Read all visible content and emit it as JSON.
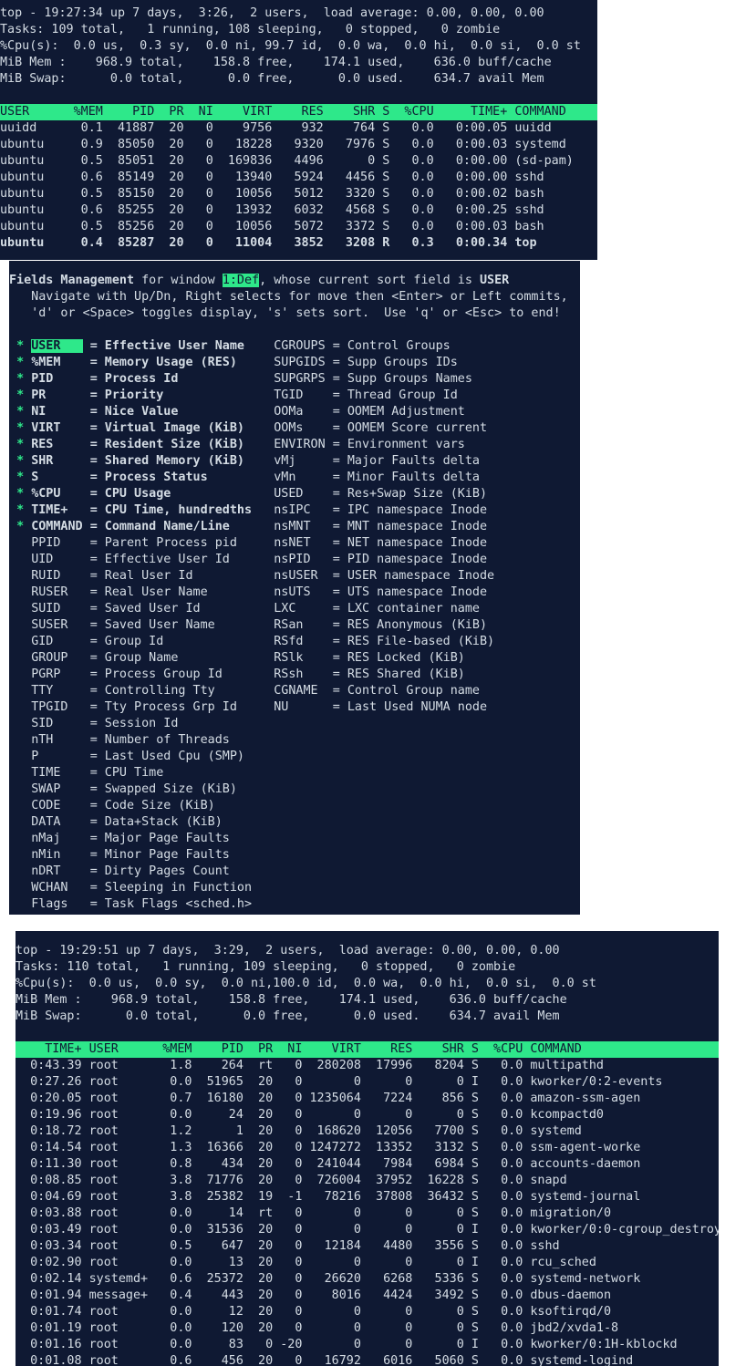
{
  "panel1": {
    "summary": [
      "top - 19:27:34 up 7 days,  3:26,  2 users,  load average: 0.00, 0.00, 0.00",
      "Tasks: 109 total,   1 running, 108 sleeping,   0 stopped,   0 zombie",
      "%Cpu(s):  0.0 us,  0.3 sy,  0.0 ni, 99.7 id,  0.0 wa,  0.0 hi,  0.0 si,  0.0 st",
      "MiB Mem :    968.9 total,    158.8 free,    174.1 used,    636.0 buff/cache",
      "MiB Swap:      0.0 total,      0.0 free,      0.0 used.    634.7 avail Mem"
    ],
    "header": "USER      %MEM    PID  PR  NI    VIRT    RES    SHR S  %CPU     TIME+ COMMAND         ",
    "rows": [
      "uuidd      0.1  41887  20   0    9756    932    764 S   0.0   0:00.05 uuidd",
      "ubuntu     0.9  85050  20   0   18228   9320   7976 S   0.0   0:00.03 systemd",
      "ubuntu     0.5  85051  20   0  169836   4496      0 S   0.0   0:00.00 (sd-pam)",
      "ubuntu     0.6  85149  20   0   13940   5924   4456 S   0.0   0:00.00 sshd",
      "ubuntu     0.5  85150  20   0   10056   5012   3320 S   0.0   0:00.02 bash",
      "ubuntu     0.6  85255  20   0   13932   6032   4568 S   0.0   0:00.25 sshd",
      "ubuntu     0.5  85256  20   0   10056   5072   3372 S   0.0   0:00.03 bash"
    ],
    "active_row": "ubuntu     0.4  85287  20   0   11004   3852   3208 R   0.3   0:00.34 top"
  },
  "panel2": {
    "title_a": "Fields Management",
    "title_b": " for window ",
    "window": "1:Def",
    "title_c": ", whose current sort field is ",
    "sort_field": "USER",
    "instructions": [
      "   Navigate with Up/Dn, Right selects for move then <Enter> or Left commits,",
      "   'd' or <Space> toggles display, 's' sets sort.  Use 'q' or <Esc> to end!"
    ],
    "left_fields": [
      {
        "mark": "*",
        "name": "USER   ",
        "desc": "= Effective User Name ",
        "on": true,
        "sel": true
      },
      {
        "mark": "*",
        "name": "%MEM   ",
        "desc": "= Memory Usage (RES)  ",
        "on": true
      },
      {
        "mark": "*",
        "name": "PID    ",
        "desc": "= Process Id          ",
        "on": true
      },
      {
        "mark": "*",
        "name": "PR     ",
        "desc": "= Priority            ",
        "on": true
      },
      {
        "mark": "*",
        "name": "NI     ",
        "desc": "= Nice Value          ",
        "on": true
      },
      {
        "mark": "*",
        "name": "VIRT   ",
        "desc": "= Virtual Image (KiB) ",
        "on": true
      },
      {
        "mark": "*",
        "name": "RES    ",
        "desc": "= Resident Size (KiB) ",
        "on": true
      },
      {
        "mark": "*",
        "name": "SHR    ",
        "desc": "= Shared Memory (KiB) ",
        "on": true
      },
      {
        "mark": "*",
        "name": "S      ",
        "desc": "= Process Status      ",
        "on": true
      },
      {
        "mark": "*",
        "name": "%CPU   ",
        "desc": "= CPU Usage           ",
        "on": true
      },
      {
        "mark": "*",
        "name": "TIME+  ",
        "desc": "= CPU Time, hundredths",
        "on": true
      },
      {
        "mark": "*",
        "name": "COMMAND",
        "desc": "= Command Name/Line   ",
        "on": true
      },
      {
        "mark": " ",
        "name": "PPID   ",
        "desc": "= Parent Process pid  ",
        "on": false
      },
      {
        "mark": " ",
        "name": "UID    ",
        "desc": "= Effective User Id   ",
        "on": false
      },
      {
        "mark": " ",
        "name": "RUID   ",
        "desc": "= Real User Id        ",
        "on": false
      },
      {
        "mark": " ",
        "name": "RUSER  ",
        "desc": "= Real User Name      ",
        "on": false
      },
      {
        "mark": " ",
        "name": "SUID   ",
        "desc": "= Saved User Id       ",
        "on": false
      },
      {
        "mark": " ",
        "name": "SUSER  ",
        "desc": "= Saved User Name     ",
        "on": false
      },
      {
        "mark": " ",
        "name": "GID    ",
        "desc": "= Group Id            ",
        "on": false
      },
      {
        "mark": " ",
        "name": "GROUP  ",
        "desc": "= Group Name          ",
        "on": false
      },
      {
        "mark": " ",
        "name": "PGRP   ",
        "desc": "= Process Group Id    ",
        "on": false
      },
      {
        "mark": " ",
        "name": "TTY    ",
        "desc": "= Controlling Tty     ",
        "on": false
      },
      {
        "mark": " ",
        "name": "TPGID  ",
        "desc": "= Tty Process Grp Id  ",
        "on": false
      },
      {
        "mark": " ",
        "name": "SID    ",
        "desc": "= Session Id          ",
        "on": false
      },
      {
        "mark": " ",
        "name": "nTH    ",
        "desc": "= Number of Threads   ",
        "on": false
      },
      {
        "mark": " ",
        "name": "P      ",
        "desc": "= Last Used Cpu (SMP) ",
        "on": false
      },
      {
        "mark": " ",
        "name": "TIME   ",
        "desc": "= CPU Time            ",
        "on": false
      },
      {
        "mark": " ",
        "name": "SWAP   ",
        "desc": "= Swapped Size (KiB)  ",
        "on": false
      },
      {
        "mark": " ",
        "name": "CODE   ",
        "desc": "= Code Size (KiB)     ",
        "on": false
      },
      {
        "mark": " ",
        "name": "DATA   ",
        "desc": "= Data+Stack (KiB)    ",
        "on": false
      },
      {
        "mark": " ",
        "name": "nMaj   ",
        "desc": "= Major Page Faults   ",
        "on": false
      },
      {
        "mark": " ",
        "name": "nMin   ",
        "desc": "= Minor Page Faults   ",
        "on": false
      },
      {
        "mark": " ",
        "name": "nDRT   ",
        "desc": "= Dirty Pages Count   ",
        "on": false
      },
      {
        "mark": " ",
        "name": "WCHAN  ",
        "desc": "= Sleeping in Function",
        "on": false
      },
      {
        "mark": " ",
        "name": "Flags  ",
        "desc": "= Task Flags <sched.h>",
        "on": false
      }
    ],
    "right_fields": [
      "CGROUPS = Control Groups",
      "SUPGIDS = Supp Groups IDs",
      "SUPGRPS = Supp Groups Names",
      "TGID    = Thread Group Id",
      "OOMa    = OOMEM Adjustment",
      "OOMs    = OOMEM Score current",
      "ENVIRON = Environment vars",
      "vMj     = Major Faults delta",
      "vMn     = Minor Faults delta",
      "USED    = Res+Swap Size (KiB)",
      "nsIPC   = IPC namespace Inode",
      "nsMNT   = MNT namespace Inode",
      "nsNET   = NET namespace Inode",
      "nsPID   = PID namespace Inode",
      "nsUSER  = USER namespace Inode",
      "nsUTS   = UTS namespace Inode",
      "LXC     = LXC container name",
      "RSan    = RES Anonymous (KiB)",
      "RSfd    = RES File-based (KiB)",
      "RSlk    = RES Locked (KiB)",
      "RSsh    = RES Shared (KiB)",
      "CGNAME  = Control Group name",
      "NU      = Last Used NUMA node"
    ]
  },
  "panel3": {
    "summary": [
      "top - 19:29:51 up 7 days,  3:29,  2 users,  load average: 0.00, 0.00, 0.00",
      "Tasks: 110 total,   1 running, 109 sleeping,   0 stopped,   0 zombie",
      "%Cpu(s):  0.0 us,  0.0 sy,  0.0 ni,100.0 id,  0.0 wa,  0.0 hi,  0.0 si,  0.0 st",
      "MiB Mem :    968.9 total,    158.8 free,    174.1 used,    636.0 buff/cache",
      "MiB Swap:      0.0 total,      0.0 free,      0.0 used.    634.7 avail Mem"
    ],
    "header": "    TIME+ USER      %MEM    PID  PR  NI    VIRT    RES    SHR S  %CPU COMMAND                      ",
    "rows": [
      "  0:43.39 root       1.8    264  rt   0  280208  17996   8204 S   0.0 multipathd",
      "  0:27.26 root       0.0  51965  20   0       0      0      0 I   0.0 kworker/0:2-events",
      "  0:20.05 root       0.7  16180  20   0 1235064   7224    856 S   0.0 amazon-ssm-agen",
      "  0:19.96 root       0.0     24  20   0       0      0      0 S   0.0 kcompactd0",
      "  0:18.72 root       1.2      1  20   0  168620  12056   7700 S   0.0 systemd",
      "  0:14.54 root       1.3  16366  20   0 1247272  13352   3132 S   0.0 ssm-agent-worke",
      "  0:11.30 root       0.8    434  20   0  241044   7984   6984 S   0.0 accounts-daemon",
      "  0:08.85 root       3.8  71776  20   0  726004  37952  16228 S   0.0 snapd",
      "  0:04.69 root       3.8  25382  19  -1   78216  37808  36432 S   0.0 systemd-journal",
      "  0:03.88 root       0.0     14  rt   0       0      0      0 S   0.0 migration/0",
      "  0:03.49 root       0.0  31536  20   0       0      0      0 I   0.0 kworker/0:0-cgroup_destroy",
      "  0:03.34 root       0.5    647  20   0   12184   4480   3556 S   0.0 sshd",
      "  0:02.90 root       0.0     13  20   0       0      0      0 I   0.0 rcu_sched",
      "  0:02.14 systemd+   0.6  25372  20   0   26620   6268   5336 S   0.0 systemd-network",
      "  0:01.94 message+   0.4    443  20   0    8016   4424   3492 S   0.0 dbus-daemon",
      "  0:01.74 root       0.0     12  20   0       0      0      0 S   0.0 ksoftirqd/0",
      "  0:01.19 root       0.0    120  20   0       0      0      0 S   0.0 jbd2/xvda1-8",
      "  0:01.16 root       0.0     83   0 -20       0      0      0 I   0.0 kworker/0:1H-kblockd",
      "  0:01.08 root       0.6    456  20   0   16792   6016   5060 S   0.0 systemd-logind"
    ]
  }
}
